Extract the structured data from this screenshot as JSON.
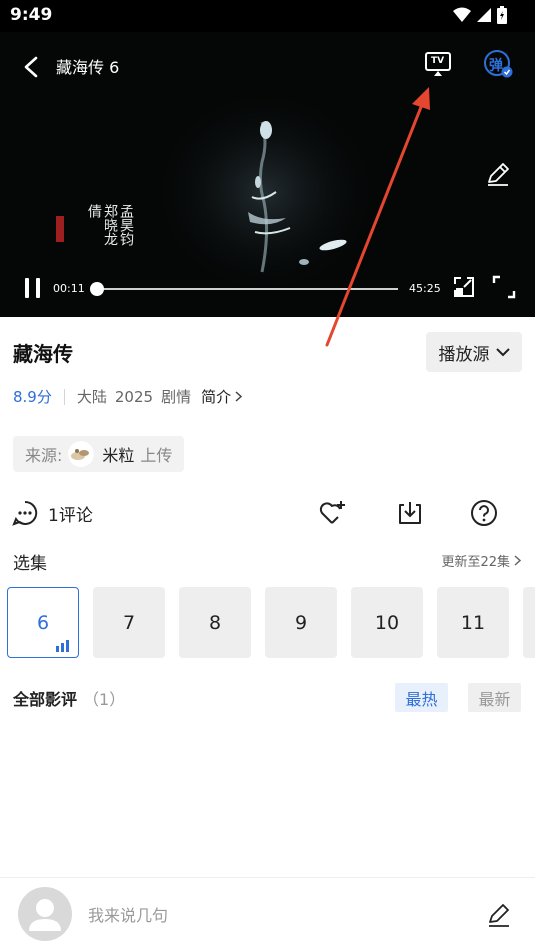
{
  "status_bar": {
    "time": "9:49",
    "icons": [
      "wifi-icon",
      "cellular-icon",
      "battery-icon"
    ]
  },
  "player": {
    "title": "藏海传 6",
    "current_time": "00:11",
    "total_time": "45:25",
    "progress": 0.004,
    "danmu_label": "弹",
    "cast_label": "TV",
    "credits_text": "孟昊钧 郑晓龙 倩"
  },
  "show": {
    "title": "藏海传",
    "source_button_label": "播放源",
    "score": "8.9分",
    "region": "大陆",
    "year": "2025",
    "genre": "剧情",
    "intro_label": "简介"
  },
  "uploader": {
    "prefix": "来源:",
    "name": "米粒",
    "suffix": "上传"
  },
  "actions": {
    "comment_label": "1评论"
  },
  "episodes": {
    "label": "选集",
    "update_text": "更新至22集",
    "items": [
      "6",
      "7",
      "8",
      "9",
      "10",
      "11"
    ],
    "active": "6"
  },
  "reviews": {
    "title": "全部影评",
    "count": "（1）",
    "sort_hot": "最热",
    "sort_new": "最新"
  },
  "comment_bar": {
    "placeholder": "我来说几句"
  },
  "colors": {
    "accent": "#2f6fd8",
    "annotation_arrow": "#e5462f"
  }
}
